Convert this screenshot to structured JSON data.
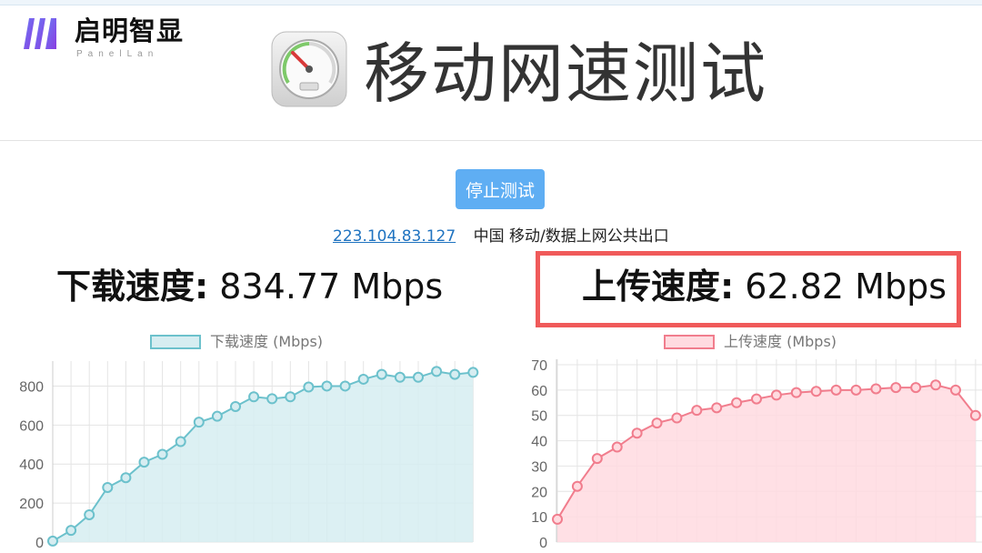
{
  "brand": {
    "name": "启明智显",
    "sub": "PanelLan"
  },
  "header": {
    "title": "移动网速测试"
  },
  "controls": {
    "stop_label": "停止测试"
  },
  "connection": {
    "ip": "223.104.83.127",
    "info": "中国 移动/数据上网公共出口"
  },
  "download": {
    "label": "下载速度:",
    "value": "834.77 Mbps"
  },
  "upload": {
    "label": "上传速度:",
    "value": "62.82 Mbps"
  },
  "colors": {
    "dl_line": "#6cc1cc",
    "dl_fill": "#d6edf1",
    "ul_line": "#f17d8d",
    "ul_fill": "#ffdbe0",
    "highlight": "#f05a5a",
    "button": "#5faef3"
  },
  "chart_data": [
    {
      "type": "line",
      "series": [
        {
          "name": "下载速度 (Mbps)",
          "values": [
            5,
            60,
            140,
            280,
            330,
            410,
            450,
            515,
            615,
            645,
            695,
            745,
            735,
            745,
            795,
            800,
            800,
            835,
            860,
            845,
            845,
            875,
            860,
            870
          ]
        }
      ],
      "ylim": [
        0,
        900
      ],
      "yticks": [
        0,
        200,
        400,
        600,
        800
      ],
      "grid": true,
      "legend": "top-center"
    },
    {
      "type": "line",
      "series": [
        {
          "name": "上传速度 (Mbps)",
          "values": [
            9,
            22,
            33,
            37.5,
            43,
            47,
            49,
            52,
            53,
            55,
            56.5,
            58,
            59,
            59.5,
            60,
            60,
            60.5,
            61,
            61,
            62,
            60,
            50
          ]
        }
      ],
      "ylim": [
        0,
        70
      ],
      "yticks": [
        0,
        10,
        20,
        30,
        40,
        50,
        60,
        70
      ],
      "grid": true,
      "legend": "top-center"
    }
  ]
}
